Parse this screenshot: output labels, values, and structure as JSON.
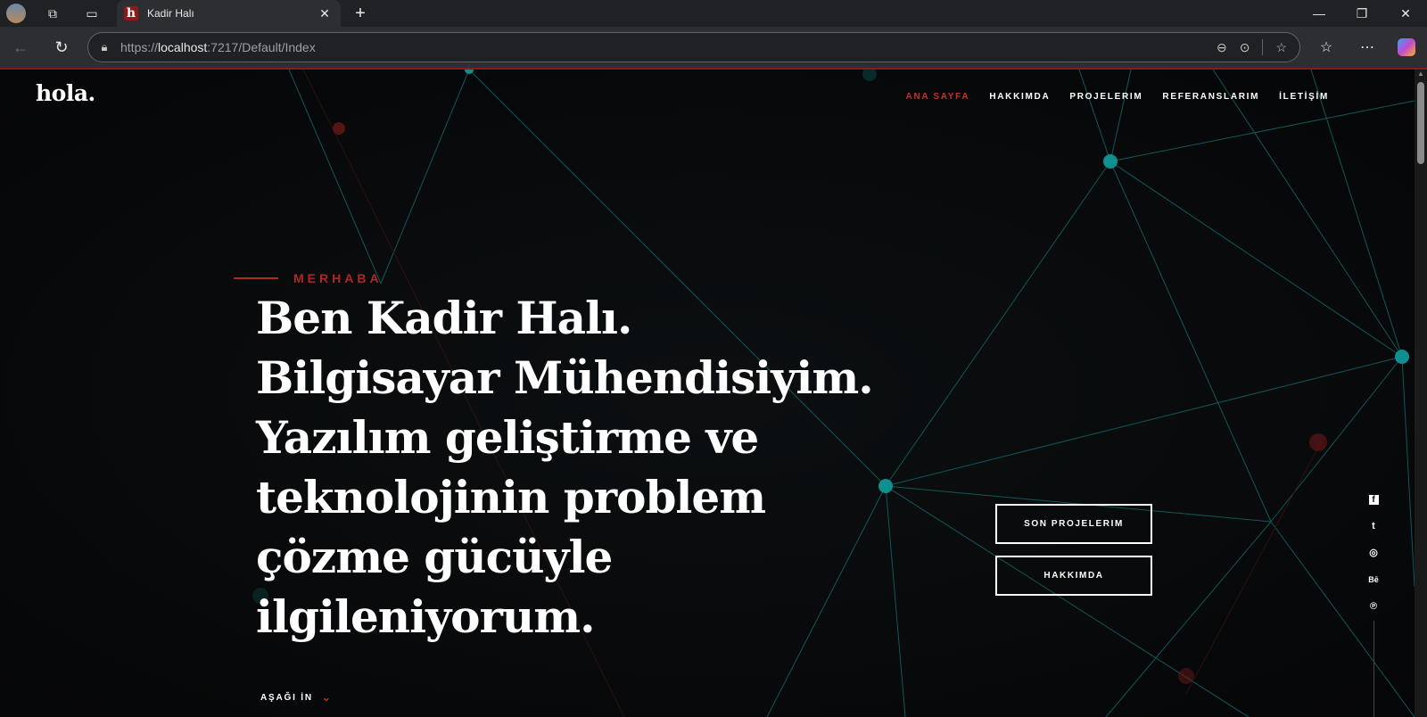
{
  "browser": {
    "tab_title": "Kadir Halı",
    "tab_favicon": "h",
    "url_prefix": "https://",
    "url_host": "localhost",
    "url_path": ":7217/Default/Index"
  },
  "site": {
    "logo": "hola.",
    "nav": [
      {
        "label": "ANA SAYFA"
      },
      {
        "label": "HAKKIMDA"
      },
      {
        "label": "PROJELERIM"
      },
      {
        "label": "REFERANSLARIM"
      },
      {
        "label": "İLETİŞİM"
      }
    ],
    "greeting": "MERHABA",
    "headline": "Ben Kadir Halı. Bilgisayar Mühendisiyim. Yazılım geliştirme ve teknolojinin problem çözme gücüyle ilgileniyorum.",
    "buttons": {
      "projects": "SON PROJELERIM",
      "about": "HAKKIMDA"
    },
    "scroll_down": "AŞAĞI İN",
    "social_icons": [
      "facebook-icon",
      "twitter-icon",
      "instagram-icon",
      "behance-icon",
      "pinterest-icon"
    ],
    "social_glyphs": {
      "facebook": "f",
      "twitter": "t",
      "instagram": "◎",
      "behance": "Bē",
      "pinterest": "℗"
    }
  },
  "colors": {
    "accent": "#c0322b",
    "network_lines": "#1a6b6b",
    "node": "#0f8f8f",
    "background": "#080a0c"
  }
}
